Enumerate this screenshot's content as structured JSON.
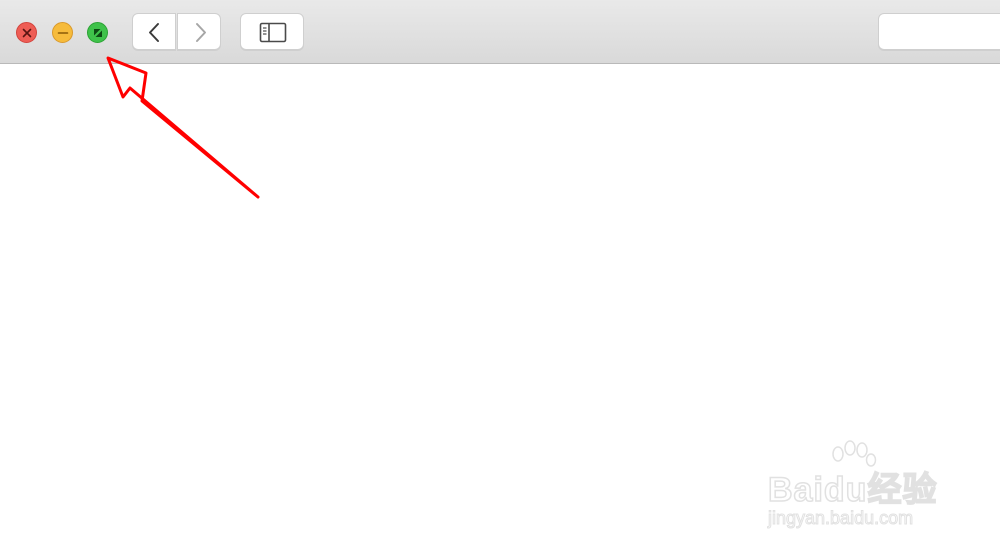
{
  "window": {
    "traffic_lights": [
      {
        "name": "close",
        "icon": "close-icon",
        "color": "#ee5d55"
      },
      {
        "name": "minimize",
        "icon": "minimize-icon",
        "color": "#f6bb3b"
      },
      {
        "name": "fullscreen",
        "icon": "fullscreen-icon",
        "color": "#3fc24a"
      }
    ]
  },
  "toolbar": {
    "back_icon": "chevron-left-icon",
    "forward_icon": "chevron-right-icon",
    "sidebar_icon": "sidebar-toggle-icon",
    "search_value": ""
  },
  "annotation": {
    "arrow_color": "#ff0000"
  },
  "watermark": {
    "brand": "Baidu经验",
    "site": "jingyan.baidu.com"
  }
}
